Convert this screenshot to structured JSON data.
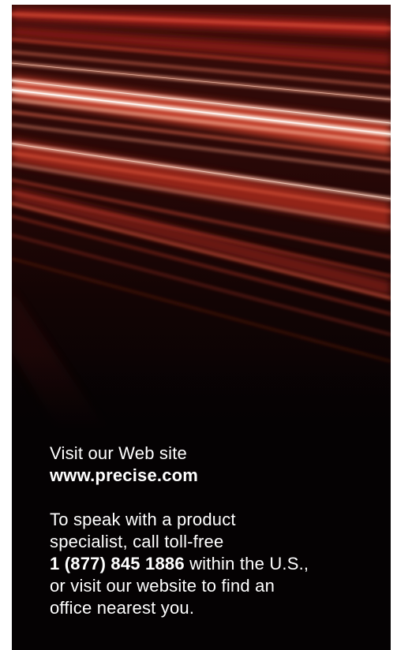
{
  "visit": {
    "label": "Visit our Web site",
    "url": "www.precise.com"
  },
  "contact": {
    "line1": "To speak with a product",
    "line2": "specialist, call toll-free",
    "phone": "1 (877) 845 1886",
    "phone_suffix": " within the U.S.,",
    "line4": "or visit our website to find an",
    "line5": "office nearest you."
  },
  "colors": {
    "background": "#050203",
    "streak_primary": "#e0523a",
    "streak_highlight": "#ffe6d8",
    "text": "#ffffff"
  }
}
